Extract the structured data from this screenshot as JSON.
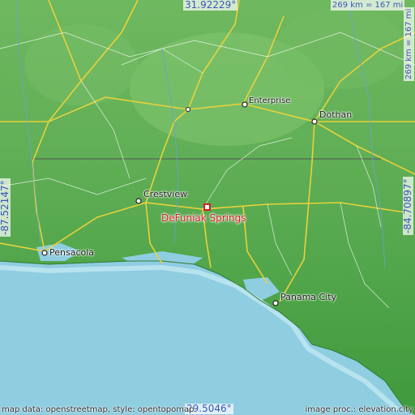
{
  "map": {
    "location_name": "DeFuniak Springs",
    "cities": [
      {
        "name": "Enterprise"
      },
      {
        "name": "Dothan"
      },
      {
        "name": "Crestview"
      },
      {
        "name": "Pensacola"
      },
      {
        "name": "Panama City"
      }
    ],
    "coords": {
      "lat_top": "31.92229°",
      "lat_bottom": "29.5046°",
      "lon_left": "-87.52147°",
      "lon_right": "-84.70897°"
    },
    "scale": {
      "top": "269 km = 167 mi",
      "right": "269 km = 167 mi"
    },
    "credits": {
      "left": "map data: openstreetmap, style: opentopomap",
      "right": "image proc.: elevation.city"
    },
    "colors": {
      "sea": "#8fcde0",
      "land_low": "#3f9e3f",
      "land_high": "#7ec36d",
      "marker": "#d42020",
      "coord_text": "#3b56b8"
    }
  }
}
